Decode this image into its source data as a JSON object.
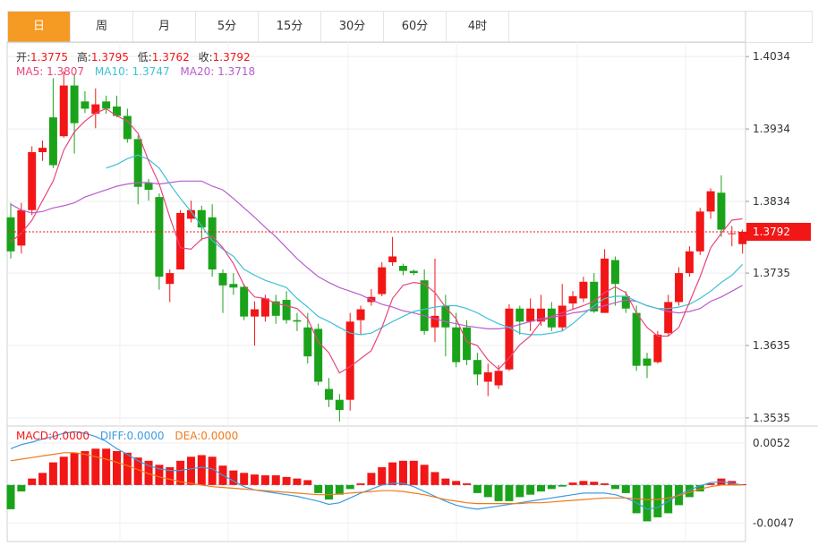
{
  "tabs": [
    {
      "label": "日",
      "active": true
    },
    {
      "label": "周",
      "active": false
    },
    {
      "label": "月",
      "active": false
    },
    {
      "label": "5分",
      "active": false
    },
    {
      "label": "15分",
      "active": false
    },
    {
      "label": "30分",
      "active": false
    },
    {
      "label": "60分",
      "active": false
    },
    {
      "label": "4时",
      "active": false
    }
  ],
  "ohlc_info": {
    "open_label": "开:",
    "open": "1.3775",
    "high_label": "高:",
    "high": "1.3795",
    "low_label": "低:",
    "low": "1.3762",
    "close_label": "收:",
    "close": "1.3792"
  },
  "ma_info": {
    "ma5_label": "MA5: ",
    "ma5": "1.3807",
    "ma10_label": "MA10: ",
    "ma10": "1.3747",
    "ma20_label": "MA20: ",
    "ma20": "1.3718"
  },
  "macd_info": {
    "macd_label": "MACD:",
    "macd": "0.0000",
    "diff_label": "DIFF:",
    "diff": "0.0000",
    "dea_label": "DEA:",
    "dea": "0.0000"
  },
  "colors": {
    "up": "#f21616",
    "down": "#1aa31a",
    "ma5": "#e8457c",
    "ma10": "#3fc1d8",
    "ma20": "#b85ccf",
    "diff": "#3c9be0",
    "dea": "#f07a1a",
    "active_tab": "#f59a23"
  },
  "chart_data": [
    {
      "type": "candlestick",
      "y_ticks": [
        "1.4034",
        "1.3934",
        "1.3834",
        "1.3735",
        "1.3635",
        "1.3535"
      ],
      "ylim": [
        1.3525,
        1.4054
      ],
      "last_price_label": "1.3792",
      "last_price": 1.3792,
      "candles": [
        [
          1.3812,
          1.3765,
          1.3832,
          1.3755
        ],
        [
          1.3773,
          1.3822,
          1.3832,
          1.3762
        ],
        [
          1.3822,
          1.3902,
          1.391,
          1.3815
        ],
        [
          1.3902,
          1.3908,
          1.3918,
          1.389
        ],
        [
          1.395,
          1.3884,
          1.4004,
          1.388
        ],
        [
          1.3924,
          1.3994,
          1.4014,
          1.3922
        ],
        [
          1.3994,
          1.3942,
          1.401,
          1.39
        ],
        [
          1.3972,
          1.3962,
          1.3986,
          1.3956
        ],
        [
          1.3955,
          1.3968,
          1.399,
          1.3935
        ],
        [
          1.3972,
          1.3962,
          1.398,
          1.3955
        ],
        [
          1.3965,
          1.3952,
          1.398,
          1.395
        ],
        [
          1.3952,
          1.392,
          1.3962,
          1.3915
        ],
        [
          1.392,
          1.3854,
          1.3925,
          1.383
        ],
        [
          1.386,
          1.385,
          1.3865,
          1.3835
        ],
        [
          1.384,
          1.373,
          1.3845,
          1.3712
        ],
        [
          1.372,
          1.3735,
          1.374,
          1.3695
        ],
        [
          1.374,
          1.3818,
          1.3822,
          1.374
        ],
        [
          1.381,
          1.3822,
          1.3835,
          1.3805
        ],
        [
          1.3822,
          1.3798,
          1.3828,
          1.378
        ],
        [
          1.3812,
          1.374,
          1.383,
          1.373
        ],
        [
          1.3735,
          1.3718,
          1.374,
          1.368
        ],
        [
          1.372,
          1.3715,
          1.3735,
          1.3705
        ],
        [
          1.3716,
          1.3675,
          1.372,
          1.367
        ],
        [
          1.3675,
          1.3685,
          1.3696,
          1.3635
        ],
        [
          1.3675,
          1.37,
          1.3705,
          1.3668
        ],
        [
          1.3696,
          1.3676,
          1.3705,
          1.3665
        ],
        [
          1.3698,
          1.367,
          1.371,
          1.3665
        ],
        [
          1.367,
          1.3668,
          1.368,
          1.3655
        ],
        [
          1.366,
          1.362,
          1.368,
          1.361
        ],
        [
          1.3658,
          1.3585,
          1.3665,
          1.358
        ],
        [
          1.3575,
          1.356,
          1.359,
          1.355
        ],
        [
          1.356,
          1.3546,
          1.3568,
          1.353
        ],
        [
          1.356,
          1.3668,
          1.368,
          1.3545
        ],
        [
          1.367,
          1.3685,
          1.369,
          1.365
        ],
        [
          1.3695,
          1.3702,
          1.3713,
          1.369
        ],
        [
          1.3706,
          1.3743,
          1.375,
          1.3703
        ],
        [
          1.375,
          1.3758,
          1.3785,
          1.3745
        ],
        [
          1.3745,
          1.3738,
          1.3748,
          1.3732
        ],
        [
          1.3738,
          1.3735,
          1.374,
          1.3732
        ],
        [
          1.3725,
          1.3655,
          1.374,
          1.365
        ],
        [
          1.366,
          1.3676,
          1.3755,
          1.364
        ],
        [
          1.369,
          1.366,
          1.3705,
          1.362
        ],
        [
          1.366,
          1.3612,
          1.368,
          1.3605
        ],
        [
          1.366,
          1.3615,
          1.367,
          1.3608
        ],
        [
          1.3615,
          1.3595,
          1.3625,
          1.358
        ],
        [
          1.3585,
          1.3598,
          1.361,
          1.3565
        ],
        [
          1.358,
          1.36,
          1.3608,
          1.3575
        ],
        [
          1.3602,
          1.3686,
          1.3692,
          1.36
        ],
        [
          1.3686,
          1.3668,
          1.369,
          1.365
        ],
        [
          1.3668,
          1.3686,
          1.37,
          1.3655
        ],
        [
          1.3668,
          1.3686,
          1.3705,
          1.3662
        ],
        [
          1.3686,
          1.366,
          1.3695,
          1.3655
        ],
        [
          1.366,
          1.369,
          1.372,
          1.3655
        ],
        [
          1.3693,
          1.3703,
          1.371,
          1.3685
        ],
        [
          1.37,
          1.3723,
          1.373,
          1.3695
        ],
        [
          1.3723,
          1.3682,
          1.3735,
          1.368
        ],
        [
          1.368,
          1.3755,
          1.3768,
          1.368
        ],
        [
          1.3753,
          1.372,
          1.3758,
          1.369
        ],
        [
          1.3703,
          1.3686,
          1.371,
          1.368
        ],
        [
          1.368,
          1.3607,
          1.369,
          1.36
        ],
        [
          1.3617,
          1.3607,
          1.3625,
          1.359
        ],
        [
          1.3612,
          1.365,
          1.3655,
          1.361
        ],
        [
          1.3652,
          1.3695,
          1.3705,
          1.3648
        ],
        [
          1.3695,
          1.3735,
          1.3743,
          1.369
        ],
        [
          1.3735,
          1.3765,
          1.3772,
          1.373
        ],
        [
          1.3765,
          1.382,
          1.3825,
          1.376
        ],
        [
          1.382,
          1.3848,
          1.3852,
          1.381
        ],
        [
          1.3846,
          1.3795,
          1.387,
          1.3785
        ],
        [
          1.379,
          1.379,
          1.38,
          1.3772
        ],
        [
          1.3775,
          1.3792,
          1.3795,
          1.3762
        ]
      ],
      "ma5": [
        1.3778,
        1.379,
        1.3808,
        1.3835,
        1.3862,
        1.3905,
        1.393,
        1.3945,
        1.3956,
        1.3962,
        1.3952,
        1.3945,
        1.3928,
        1.389,
        1.3858,
        1.3812,
        1.377,
        1.3768,
        1.3782,
        1.3786,
        1.377,
        1.3748,
        1.3718,
        1.3702,
        1.37,
        1.3693,
        1.369,
        1.3686,
        1.3672,
        1.364,
        1.3625,
        1.3597,
        1.3606,
        1.3617,
        1.3628,
        1.366,
        1.37,
        1.3718,
        1.3722,
        1.372,
        1.3708,
        1.3688,
        1.3672,
        1.364,
        1.3635,
        1.3615,
        1.3602,
        1.3618,
        1.3636,
        1.3648,
        1.3668,
        1.3675,
        1.368,
        1.3685,
        1.369,
        1.3696,
        1.3708,
        1.3716,
        1.3708,
        1.368,
        1.366,
        1.3648,
        1.3648,
        1.366,
        1.3695,
        1.373,
        1.377,
        1.379,
        1.3808,
        1.381
      ],
      "ma10": [
        null,
        null,
        null,
        null,
        null,
        null,
        null,
        null,
        null,
        1.388,
        1.3885,
        1.3893,
        1.3898,
        1.3892,
        1.388,
        1.3858,
        1.3838,
        1.382,
        1.38,
        1.378,
        1.3768,
        1.3758,
        1.374,
        1.3732,
        1.3725,
        1.372,
        1.3715,
        1.37,
        1.3688,
        1.3675,
        1.3668,
        1.366,
        1.3652,
        1.365,
        1.3652,
        1.366,
        1.3668,
        1.3675,
        1.3682,
        1.3685,
        1.3688,
        1.369,
        1.369,
        1.3686,
        1.368,
        1.3672,
        1.3665,
        1.366,
        1.3652,
        1.365,
        1.365,
        1.3652,
        1.3655,
        1.3665,
        1.3678,
        1.369,
        1.37,
        1.3703,
        1.3703,
        1.3696,
        1.369,
        1.3686,
        1.3686,
        1.3688,
        1.3692,
        1.37,
        1.371,
        1.3722,
        1.3732,
        1.3747
      ],
      "ma20": [
        1.383,
        1.3822,
        1.3818,
        1.382,
        1.3825,
        1.3828,
        1.3832,
        1.384,
        1.3845,
        1.385,
        1.3855,
        1.3858,
        1.386,
        1.386,
        1.3858,
        1.386,
        1.3862,
        1.3862,
        1.3862,
        1.3855,
        1.385,
        1.3838,
        1.3825,
        1.3812,
        1.3798,
        1.3785,
        1.377,
        1.3755,
        1.3742,
        1.373,
        1.3722,
        1.3715,
        1.371,
        1.3705,
        1.3698,
        1.3692,
        1.3688,
        1.3683,
        1.368,
        1.3676,
        1.3672,
        1.3668,
        1.3665,
        1.3662,
        1.366,
        1.3658,
        1.3658,
        1.366,
        1.3664,
        1.3668,
        1.3672,
        1.3674,
        1.3676,
        1.368,
        1.3682,
        1.3686,
        1.369,
        1.3694,
        1.3698,
        1.3696,
        1.369,
        1.3686,
        1.3682,
        1.368,
        1.3682,
        1.3686,
        1.3696,
        1.3702,
        1.371,
        1.3718
      ]
    },
    {
      "type": "macd",
      "y_ticks": [
        "0.0052",
        "-0.0047"
      ],
      "ylim": [
        -0.007,
        0.0073
      ],
      "hist": [
        -0.003,
        -0.0008,
        0.0008,
        0.0015,
        0.0028,
        0.0035,
        0.004,
        0.0042,
        0.0045,
        0.0045,
        0.0042,
        0.004,
        0.0034,
        0.003,
        0.0025,
        0.0022,
        0.003,
        0.0035,
        0.0037,
        0.0035,
        0.0024,
        0.0018,
        0.0015,
        0.0013,
        0.0012,
        0.0012,
        0.001,
        0.0008,
        0.0006,
        -0.001,
        -0.0018,
        -0.0012,
        -0.0005,
        0.0002,
        0.0015,
        0.0022,
        0.0028,
        0.003,
        0.003,
        0.0025,
        0.0016,
        0.0008,
        0.0005,
        0.0002,
        -0.001,
        -0.0015,
        -0.002,
        -0.002,
        -0.0015,
        -0.0012,
        -0.0008,
        -0.0005,
        -0.0002,
        0.0003,
        0.0005,
        0.0004,
        0.0002,
        -0.0005,
        -0.001,
        -0.0035,
        -0.0045,
        -0.004,
        -0.0035,
        -0.0025,
        -0.0015,
        -0.0008,
        0.0002,
        0.0008,
        0.0005,
        0.0001
      ],
      "diff": [
        0.0045,
        0.005,
        0.0053,
        0.0057,
        0.006,
        0.0064,
        0.0066,
        0.0064,
        0.006,
        0.0054,
        0.0045,
        0.0038,
        0.003,
        0.0024,
        0.002,
        0.0018,
        0.0018,
        0.002,
        0.0022,
        0.002,
        0.0012,
        0.0005,
        -0.0002,
        -0.0006,
        -0.0008,
        -0.001,
        -0.0012,
        -0.0014,
        -0.0017,
        -0.002,
        -0.0024,
        -0.0022,
        -0.0016,
        -0.001,
        -0.0005,
        0.0,
        0.0002,
        0.0002,
        -0.0002,
        -0.0008,
        -0.0014,
        -0.002,
        -0.0025,
        -0.0028,
        -0.003,
        -0.0028,
        -0.0026,
        -0.0024,
        -0.0022,
        -0.002,
        -0.0018,
        -0.0016,
        -0.0014,
        -0.0012,
        -0.001,
        -0.001,
        -0.001,
        -0.0012,
        -0.0016,
        -0.0022,
        -0.003,
        -0.0028,
        -0.002,
        -0.0012,
        -0.0006,
        -0.0001,
        0.0003,
        0.0004,
        0.0002,
        0.0
      ],
      "dea": [
        0.003,
        0.0032,
        0.0034,
        0.0036,
        0.0038,
        0.004,
        0.004,
        0.0038,
        0.0035,
        0.0032,
        0.0028,
        0.0024,
        0.0019,
        0.0014,
        0.001,
        0.0007,
        0.0004,
        0.0002,
        0.0,
        -0.0002,
        -0.0003,
        -0.0004,
        -0.0005,
        -0.0006,
        -0.0007,
        -0.0008,
        -0.0009,
        -0.001,
        -0.0011,
        -0.0012,
        -0.0012,
        -0.0011,
        -0.001,
        -0.0009,
        -0.0008,
        -0.0007,
        -0.0007,
        -0.0008,
        -0.001,
        -0.0012,
        -0.0015,
        -0.0018,
        -0.002,
        -0.0022,
        -0.0023,
        -0.0023,
        -0.0023,
        -0.0023,
        -0.0023,
        -0.0022,
        -0.0022,
        -0.0021,
        -0.002,
        -0.0019,
        -0.0018,
        -0.0017,
        -0.0016,
        -0.0016,
        -0.0016,
        -0.0017,
        -0.0018,
        -0.0018,
        -0.0016,
        -0.0013,
        -0.0009,
        -0.0005,
        -0.0002,
        0.0,
        0.0,
        0.0
      ]
    }
  ]
}
